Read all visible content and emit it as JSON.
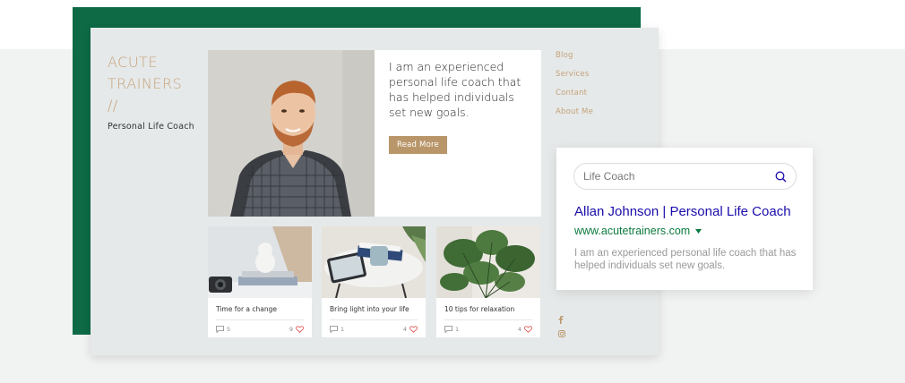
{
  "site": {
    "brand_line1": "ACUTE",
    "brand_line2": "TRAINERS",
    "brand_line3": "//",
    "tagline": "Personal Life Coach",
    "hero": {
      "intro": "I am an experienced personal life coach that has helped individuals set new goals.",
      "button_label": "Read More"
    },
    "nav": [
      "Blog",
      "Services",
      "Contant",
      "About Me"
    ],
    "posts": [
      {
        "title": "Time for a change",
        "comments": "5",
        "likes": "9"
      },
      {
        "title": "Bring light into your life",
        "comments": "1",
        "likes": "4"
      },
      {
        "title": "10 tips for relaxation",
        "comments": "1",
        "likes": "4"
      }
    ],
    "social_icons": [
      "facebook-icon",
      "instagram-icon"
    ]
  },
  "search_card": {
    "query": "Life Coach",
    "result_title": "Allan Johnson | Personal Life Coach",
    "result_url": "www.acutetrainers.com",
    "result_description": "I am an experienced personal life coach that has helped individuals set new goals."
  },
  "colors": {
    "brand_green": "#0d6a45",
    "accent_gold": "#c4a27a",
    "button_gold": "#b9966a",
    "link_blue": "#1a0dab",
    "url_green": "#0b7a3e"
  }
}
